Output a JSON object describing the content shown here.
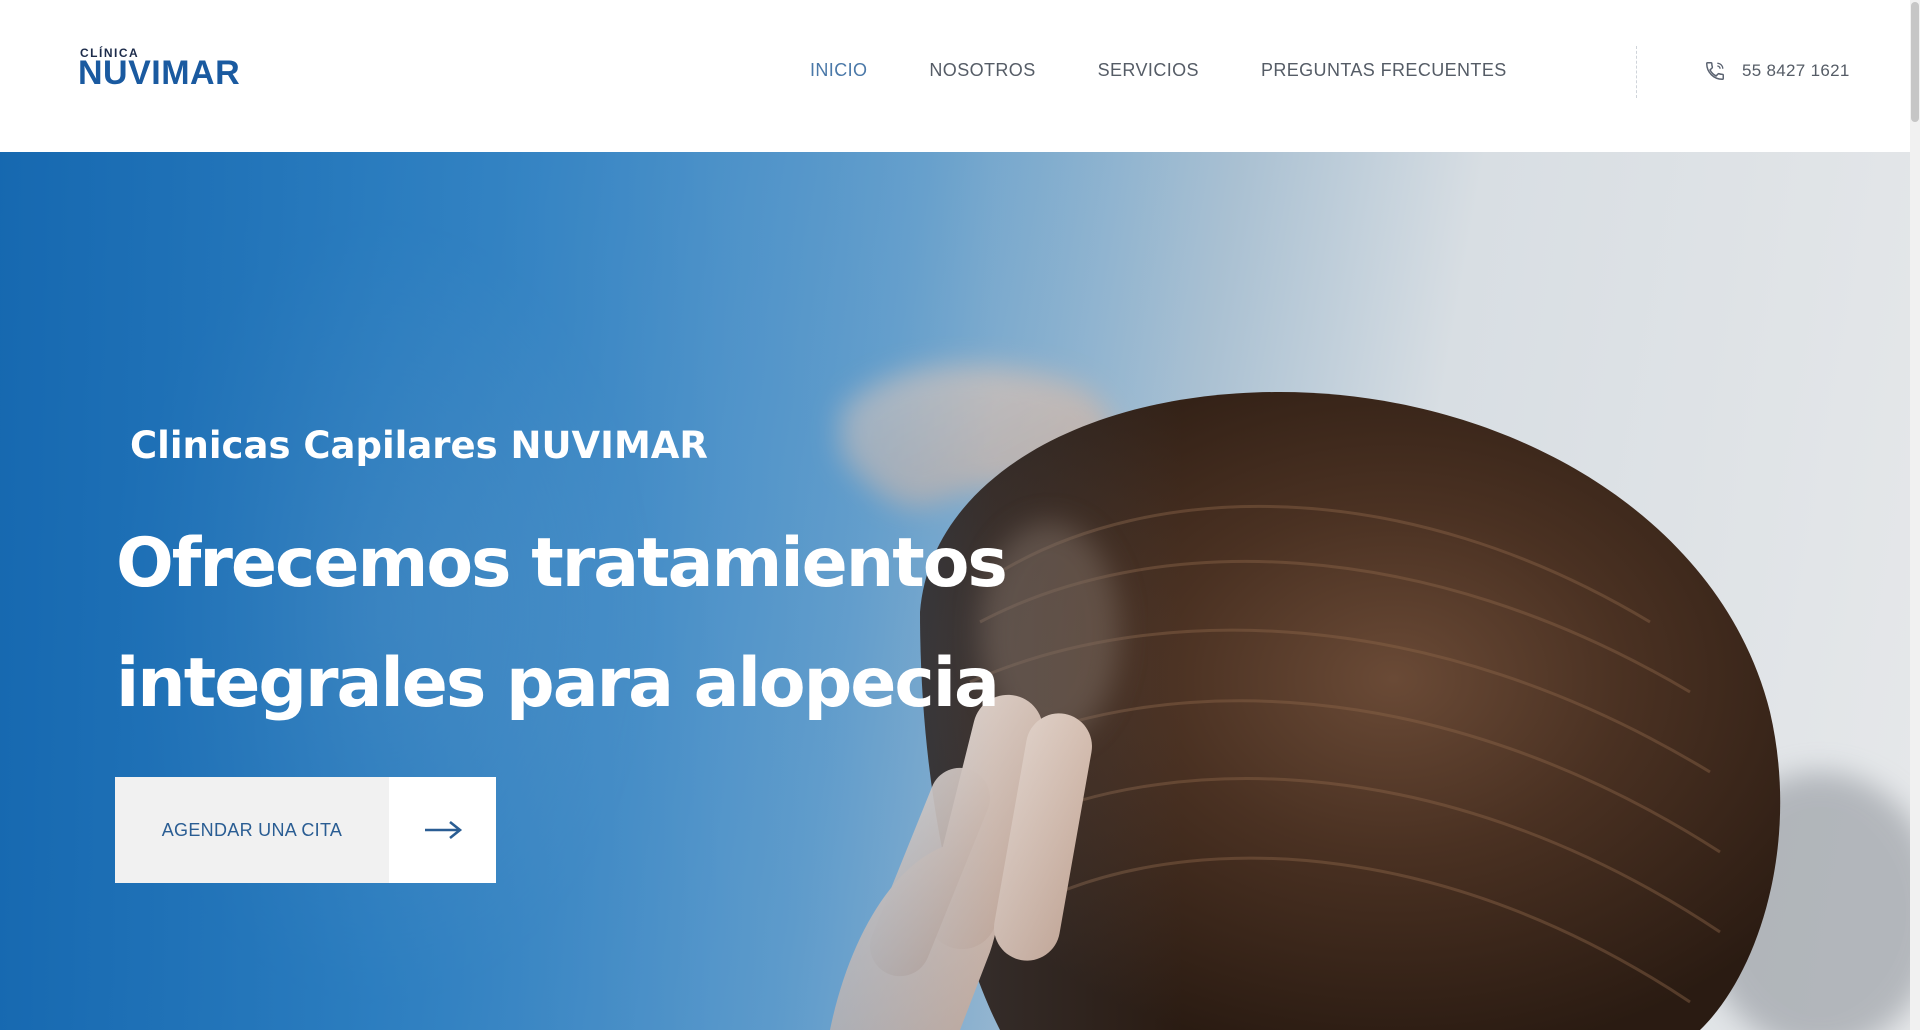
{
  "brand": {
    "small_text": "CLÍNICA",
    "big_text": "NUVIMAR",
    "color": "#1a5aa0"
  },
  "nav": {
    "items": [
      {
        "label": "INICIO",
        "active": true
      },
      {
        "label": "NOSOTROS",
        "active": false
      },
      {
        "label": "SERVICIOS",
        "active": false
      },
      {
        "label": "PREGUNTAS FRECUENTES",
        "active": false
      }
    ]
  },
  "contact": {
    "phone": "55 8427 1621",
    "icon": "phone-icon"
  },
  "hero": {
    "subtitle": "Clinicas Capilares NUVIMAR",
    "title_line1": "Ofrecemos tratamientos",
    "title_line2": "integrales para alopecia",
    "cta_label": "AGENDAR UNA CITA",
    "cta_icon": "arrow-right-icon",
    "accent_color": "#1b6fb3"
  }
}
